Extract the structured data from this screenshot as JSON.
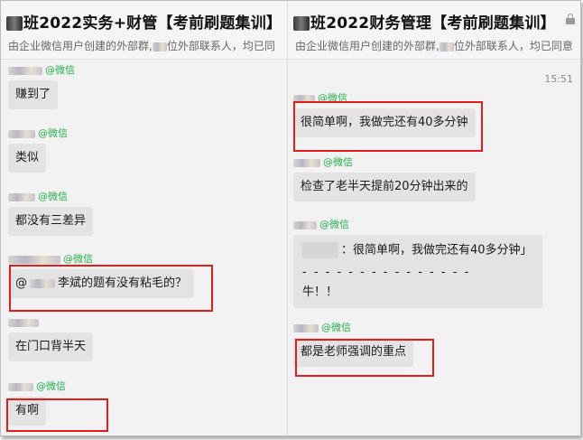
{
  "left": {
    "title": "班2022实务+财管【考前刷题集训】",
    "subtitle_a": "由企业微信用户创建的外部群,",
    "subtitle_b": "位外部联系人，均已同",
    "messages": [
      {
        "tag": "@微信",
        "text": "赚到了"
      },
      {
        "tag": "@微信",
        "text": "类似"
      },
      {
        "tag": "@微信",
        "text": "都没有三差异"
      },
      {
        "tag": "@微信",
        "at": "@",
        "text": "李斌的题有没有粘毛的？"
      },
      {
        "tag": "@微信",
        "text": "在门口背半天"
      },
      {
        "tag": "@微信",
        "text": "有啊"
      }
    ]
  },
  "right": {
    "title": "班2022财务管理【考前刷题集训】",
    "subtitle_a": "由企业微信用户创建的外部群,",
    "subtitle_b": "位外部联系人，均已同意",
    "time": "15:51",
    "messages": [
      {
        "tag": "@微信",
        "text": "很简单啊，我做完还有40多分钟"
      },
      {
        "tag": "@微信",
        "text": "检查了老半天提前20分钟出来的"
      },
      {
        "tag": "@微信",
        "quote": "：很简单啊，我做完还有40多分钟」",
        "dashes": "- - - - - - - - - - - - - - -",
        "text": "牛！！"
      },
      {
        "tag": "@微信",
        "text": "都是老师强调的重点"
      }
    ]
  },
  "colors": {
    "highlight": "#e51c1c",
    "wechat": "#23b04c",
    "bubble": "#e3e3e3"
  }
}
